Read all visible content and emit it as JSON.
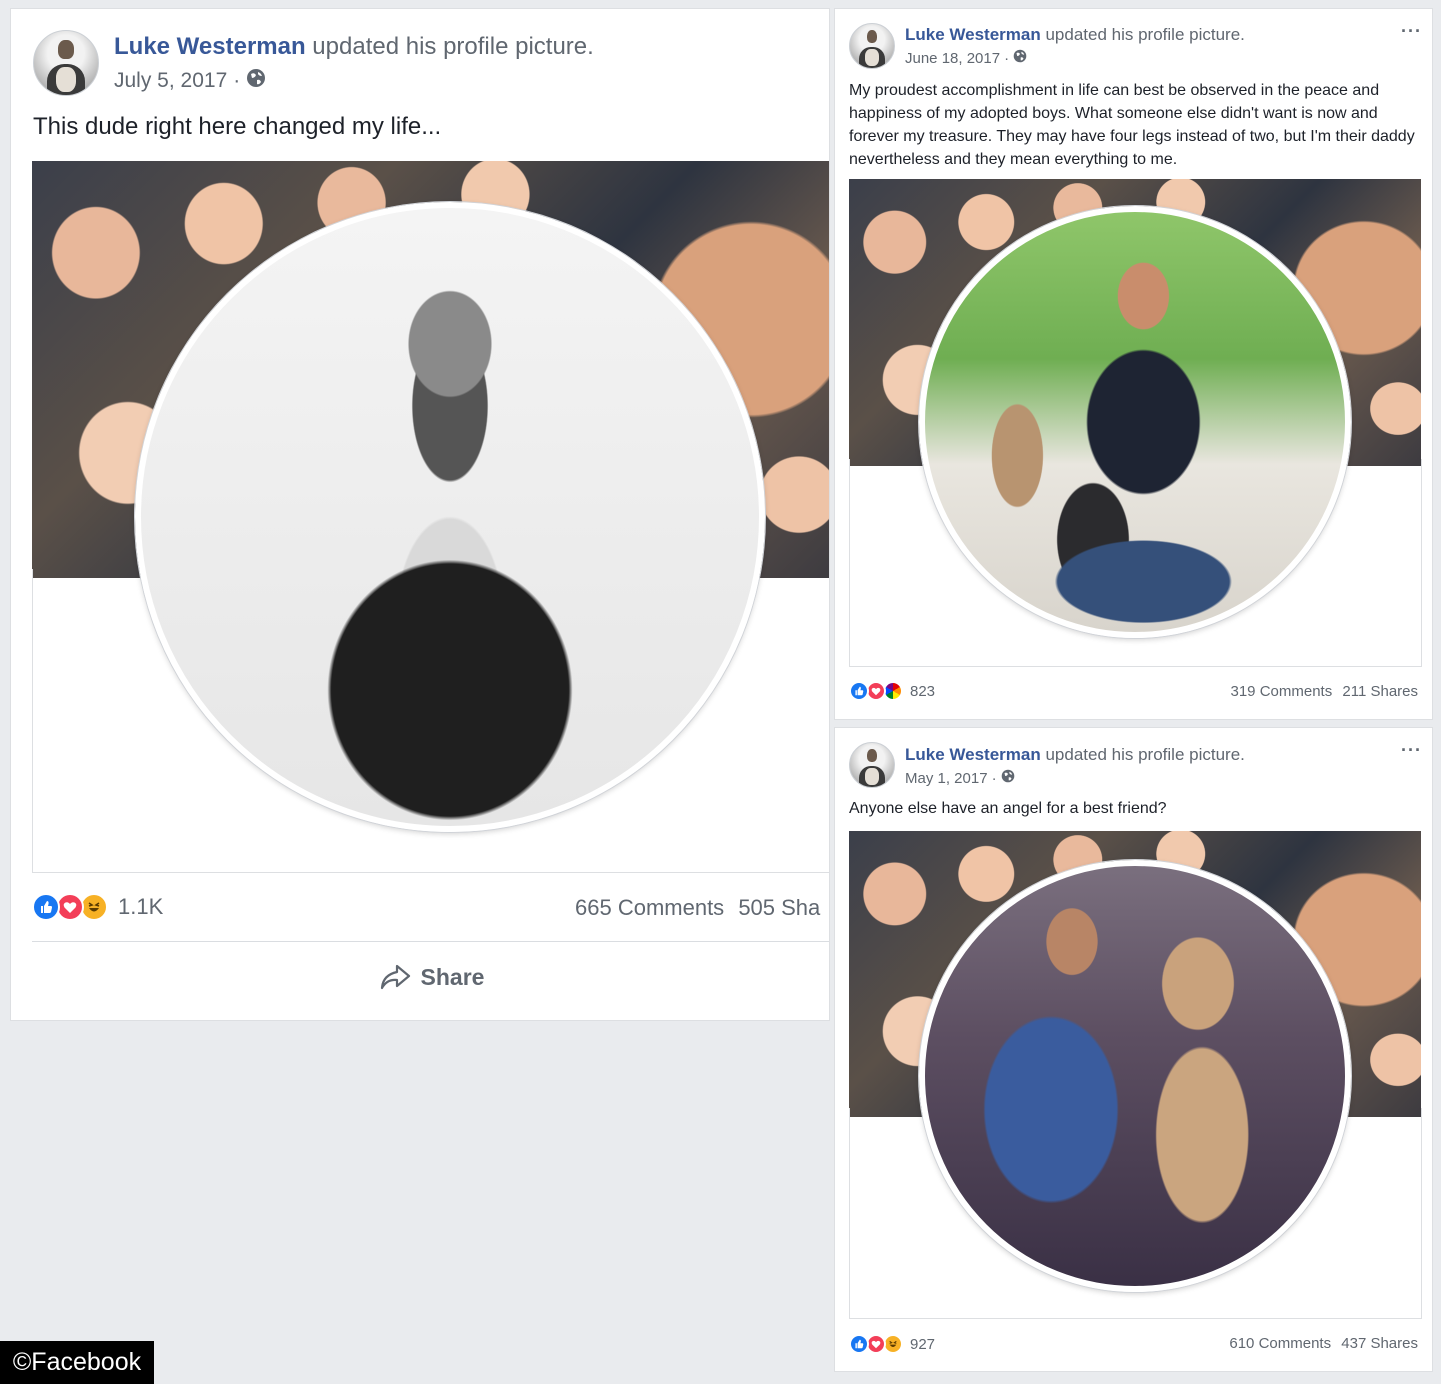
{
  "posts": [
    {
      "author": "Luke Westerman",
      "action": "updated his profile picture.",
      "date": "July 5, 2017",
      "date_sep": "·",
      "privacy_icon": "globe-icon",
      "text": "This dude right here changed my life...",
      "reaction_types": [
        "like-icon",
        "love-icon",
        "haha-icon"
      ],
      "reaction_count": "1.1K",
      "comments": "665 Comments",
      "shares": "505 Sha",
      "share_label": "Share"
    },
    {
      "author": "Luke Westerman",
      "action": "updated his profile picture.",
      "date": "June 18, 2017",
      "date_sep": "·",
      "privacy_icon": "globe-icon",
      "more_label": "···",
      "text": "My proudest accomplishment in life can best be observed in the peace and happiness of my adopted boys. What someone else didn't want is now and forever my treasure. They may have four legs instead of two, but I'm their daddy nevertheless and they mean everything to me.",
      "reaction_types": [
        "like-icon",
        "love-icon",
        "pride-icon"
      ],
      "reaction_count": "823",
      "comments": "319 Comments",
      "shares": "211 Shares"
    },
    {
      "author": "Luke Westerman",
      "action": "updated his profile picture.",
      "date": "May 1, 2017",
      "date_sep": "·",
      "privacy_icon": "globe-icon",
      "more_label": "···",
      "text": "Anyone else have an angel for a best friend?",
      "reaction_types": [
        "like-icon",
        "love-icon",
        "haha-icon"
      ],
      "reaction_count": "927",
      "comments": "610 Comments",
      "shares": "437 Shares"
    }
  ],
  "watermark": "©Facebook",
  "colors": {
    "page_bg": "#e9ebee",
    "author_link": "#385898",
    "secondary_text": "#606770",
    "like": "#1877f2",
    "love": "#f33e58",
    "haha": "#f7b125"
  }
}
